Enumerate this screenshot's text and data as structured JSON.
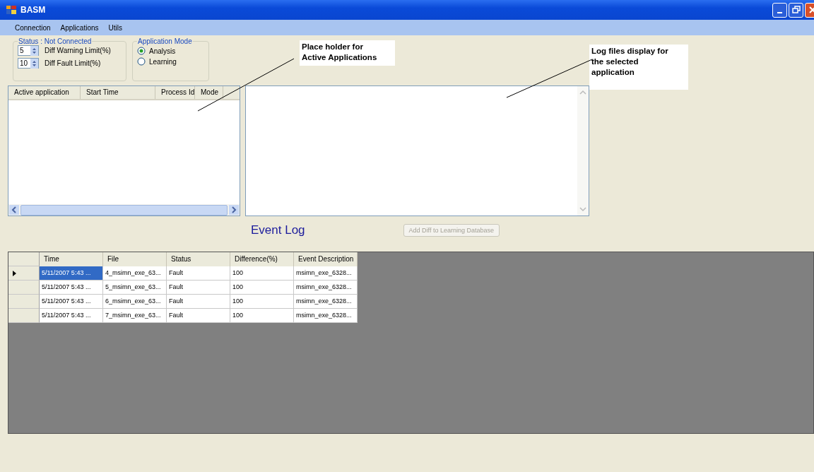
{
  "window": {
    "title": "BASM"
  },
  "menu": [
    "Connection",
    "Applications",
    "Utils"
  ],
  "status_group": {
    "title": "Status : Not Connected",
    "spinners": [
      {
        "value": "5",
        "label": "Diff Warning Limit(%)"
      },
      {
        "value": "10",
        "label": "Diff Fault Limit(%)"
      }
    ]
  },
  "mode_group": {
    "title": "Application Mode",
    "options": [
      {
        "label": "Analysis",
        "selected": true
      },
      {
        "label": "Learning",
        "selected": false
      }
    ]
  },
  "applications": {
    "columns": [
      "Active application",
      "Start Time",
      "Process Id",
      "Mode"
    ]
  },
  "callouts": [
    {
      "lines": [
        "Place holder for",
        "Active Applications"
      ]
    },
    {
      "lines": [
        "Log files display for",
        "the selected",
        "application"
      ]
    }
  ],
  "event_log": {
    "title": "Event Log",
    "button": {
      "label": "Add Diff to Learning Database",
      "disabled": true
    },
    "columns": [
      "Time",
      "File",
      "Status",
      "Difference(%)",
      "Event Description"
    ],
    "rows": [
      {
        "selected": true,
        "cells": [
          "5/11/2007 5:43 ...",
          "4_msimn_exe_63...",
          "Fault",
          "100",
          "msimn_exe_6328..."
        ]
      },
      {
        "selected": false,
        "cells": [
          "5/11/2007 5:43 ...",
          "5_msimn_exe_63...",
          "Fault",
          "100",
          "msimn_exe_6328..."
        ]
      },
      {
        "selected": false,
        "cells": [
          "5/11/2007 5:43 ...",
          "6_msimn_exe_63...",
          "Fault",
          "100",
          "msimn_exe_6328..."
        ]
      },
      {
        "selected": false,
        "cells": [
          "5/11/2007 5:43 ...",
          "7_msimn_exe_63...",
          "Fault",
          "100",
          "msimn_exe_6328..."
        ]
      }
    ]
  }
}
